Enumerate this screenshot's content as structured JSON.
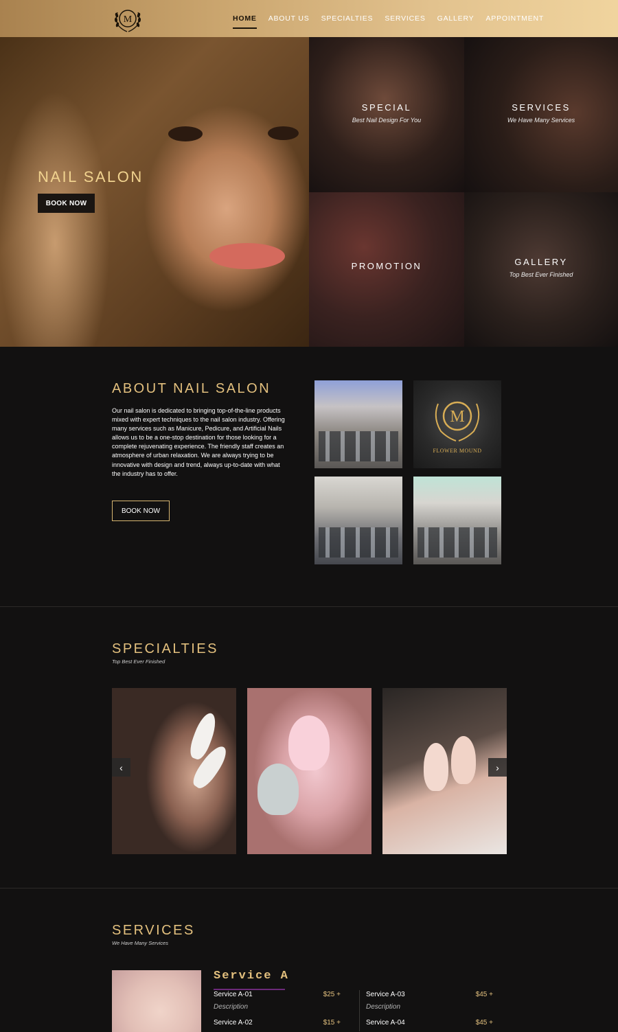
{
  "nav": {
    "logo_letter": "M",
    "items": [
      "HOME",
      "ABOUT US",
      "SPECIALTIES",
      "SERVICES",
      "GALLERY",
      "APPOINTMENT"
    ],
    "active": "HOME"
  },
  "hero": {
    "title": "NAIL SALON",
    "button": "BOOK NOW",
    "tiles": [
      {
        "title": "SPECIAL",
        "subtitle": "Best Nail Design For You"
      },
      {
        "title": "SERVICES",
        "subtitle": "We Have Many Services"
      },
      {
        "title": "PROMOTION",
        "subtitle": ""
      },
      {
        "title": "GALLERY",
        "subtitle": "Top Best Ever Finished"
      }
    ]
  },
  "about": {
    "title": "ABOUT NAIL SALON",
    "text": "Our nail salon is dedicated to bringing top-of-the-line products mixed with expert techniques to the nail salon industry. Offering many services such as Manicure, Pedicure, and Artificial Nails allows us to be a one-stop destination for those looking for a complete rejuvenating experience. The friendly staff creates an atmosphere of urban relaxation. We are always trying to be innovative with design and trend, always up-to-date with what the industry has to offer.",
    "button": "BOOK NOW",
    "emblem_letter": "M",
    "emblem_text": "FLOWER MOUND"
  },
  "specialties": {
    "title": "SPECIALTIES",
    "subtitle": "Top Best Ever Finished",
    "prev_icon": "‹",
    "next_icon": "›"
  },
  "services": {
    "title": "SERVICES",
    "subtitle": "We Have Many Services",
    "group_title": "Service A",
    "items": [
      {
        "name": "Service A-01",
        "price": "$25 +",
        "desc": "Description"
      },
      {
        "name": "Service A-02",
        "price": "$15 +",
        "desc": ""
      },
      {
        "name": "Service A-03",
        "price": "$45 +",
        "desc": "Description"
      },
      {
        "name": "Service A-04",
        "price": "$45 +",
        "desc": ""
      }
    ]
  },
  "colors": {
    "gold": "#e3c07e",
    "background": "#121111"
  }
}
